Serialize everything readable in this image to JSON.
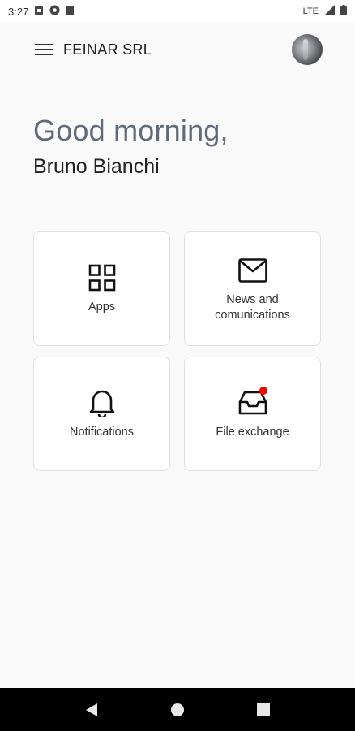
{
  "status_bar": {
    "time": "3:27",
    "network": "LTE"
  },
  "app_bar": {
    "company_name": "FEINAR SRL"
  },
  "greeting": {
    "title": "Good morning,",
    "user_name": "Bruno Bianchi"
  },
  "tiles": [
    {
      "label": "Apps",
      "icon": "grid-icon"
    },
    {
      "label": "News and\ncomunications",
      "icon": "envelope-icon"
    },
    {
      "label": "Notifications",
      "icon": "bell-icon"
    },
    {
      "label": "File exchange",
      "icon": "inbox-icon",
      "has_badge": true
    }
  ],
  "colors": {
    "badge": "#ff0000",
    "greeting": "#5f6b78",
    "background": "#fafafa"
  }
}
